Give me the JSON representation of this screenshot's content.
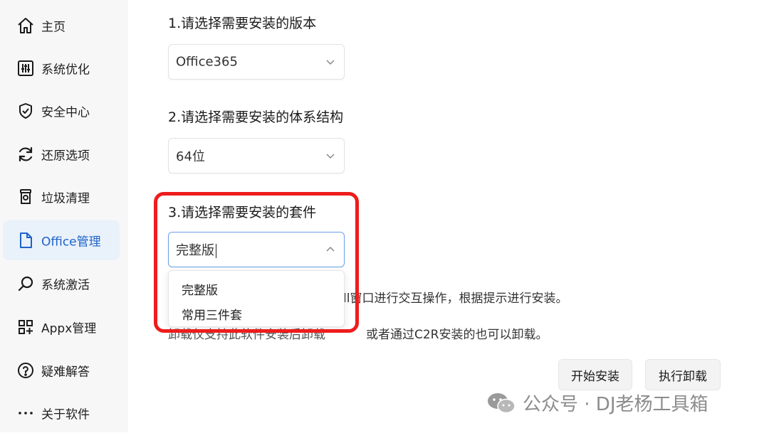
{
  "sidebar": {
    "items": [
      {
        "label": "主页",
        "icon": "home-icon"
      },
      {
        "label": "系统优化",
        "icon": "tune-icon"
      },
      {
        "label": "安全中心",
        "icon": "shield-icon"
      },
      {
        "label": "还原选项",
        "icon": "refresh-icon"
      },
      {
        "label": "垃圾清理",
        "icon": "trash-icon"
      },
      {
        "label": "Office管理",
        "icon": "document-icon",
        "active": true
      },
      {
        "label": "系统激活",
        "icon": "key-search-icon"
      },
      {
        "label": "Appx管理",
        "icon": "apps-icon"
      },
      {
        "label": "疑难解答",
        "icon": "help-icon"
      },
      {
        "label": "关于软件",
        "icon": "more-icon"
      }
    ]
  },
  "main": {
    "step1": {
      "title": "1.请选择需要安装的版本",
      "value": "Office365"
    },
    "step2": {
      "title": "2.请选择需要安装的体系结构",
      "value": "64位"
    },
    "step3": {
      "title": "3.请选择需要安装的套件",
      "value": "完整版",
      "options": [
        "完整版",
        "常用三件套"
      ]
    },
    "info_line1": "ll窗口进行交互操作，根据提示进行安装。",
    "info_line2_left": "卸载仅支持此软件安装后卸载",
    "info_line2_right": "或者通过C2R安装的也可以卸载。",
    "buttons": {
      "install": "开始安装",
      "uninstall": "执行卸载"
    }
  },
  "watermark": {
    "text": "公众号 · DJ老杨工具箱",
    "icon": "wechat-icon"
  },
  "colors": {
    "accent": "#1e63c8",
    "highlight": "#ee1c1c",
    "active_bg": "#e9f1fb"
  }
}
